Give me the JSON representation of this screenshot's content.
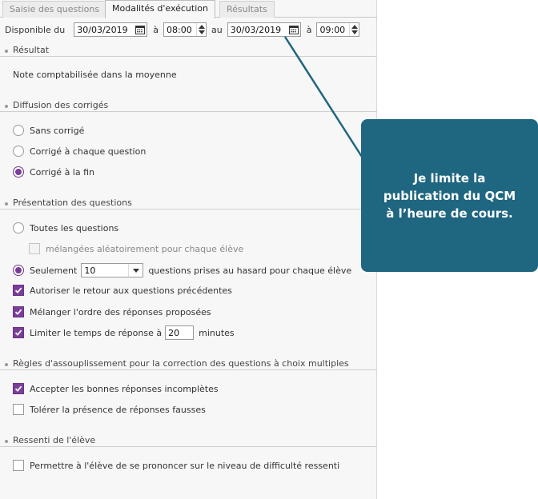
{
  "tabs": [
    {
      "label": "Saisie des questions",
      "active": false
    },
    {
      "label": "Modalités d'exécution",
      "active": true
    },
    {
      "label": "Résultats",
      "active": false
    }
  ],
  "availability": {
    "label": "Disponible du",
    "start_date": "30/03/2019",
    "start_sep": "à",
    "start_time": "08:00",
    "to_label": "au",
    "end_date": "30/03/2019",
    "end_sep": "à",
    "end_time": "09:00"
  },
  "sections": {
    "resultat": {
      "title": "Résultat",
      "note": "Note comptabilisée dans la moyenne"
    },
    "diffusion": {
      "title": "Diffusion des corrigés",
      "options": [
        {
          "label": "Sans corrigé",
          "selected": false
        },
        {
          "label": "Corrigé à chaque question",
          "selected": false
        },
        {
          "label": "Corrigé à la fin",
          "selected": true
        }
      ]
    },
    "presentation": {
      "title": "Présentation des questions",
      "all_label": "Toutes les questions",
      "all_selected": false,
      "shuffle_label": "mélangées aléatoirement pour chaque élève",
      "only_label": "Seulement",
      "only_selected": true,
      "only_count": "10",
      "only_suffix": "questions prises au hasard pour chaque élève",
      "allow_back_label": "Autoriser le retour aux questions précédentes",
      "allow_back_checked": true,
      "shuffle_answers_label": "Mélanger l'ordre des réponses proposées",
      "shuffle_answers_checked": true,
      "limit_time_label": "Limiter le temps de réponse à",
      "limit_time_checked": true,
      "limit_time_value": "20",
      "limit_time_unit": "minutes"
    },
    "regles": {
      "title": "Règles d'assouplissement pour la correction des questions à choix multiples",
      "accept_label": "Accepter les bonnes réponses incomplètes",
      "accept_checked": true,
      "tolerate_label": "Tolérer la présence de réponses fausses",
      "tolerate_checked": false
    },
    "ressenti": {
      "title": "Ressenti de l'élève",
      "allow_label": "Permettre à l'élève de se prononcer sur le niveau de difficulté ressenti",
      "allow_checked": false
    }
  },
  "callout": {
    "text": "Je limite la publication du QCM à l’heure de cours."
  },
  "colors": {
    "accent": "#7a3e98",
    "callout_bg": "#1f6680",
    "callout_text": "#ffffff"
  },
  "icons": {
    "calendar": "calendar-icon",
    "spinner": "spinner-icon",
    "dropdown": "chevron-down-icon",
    "check": "checkmark-icon"
  }
}
